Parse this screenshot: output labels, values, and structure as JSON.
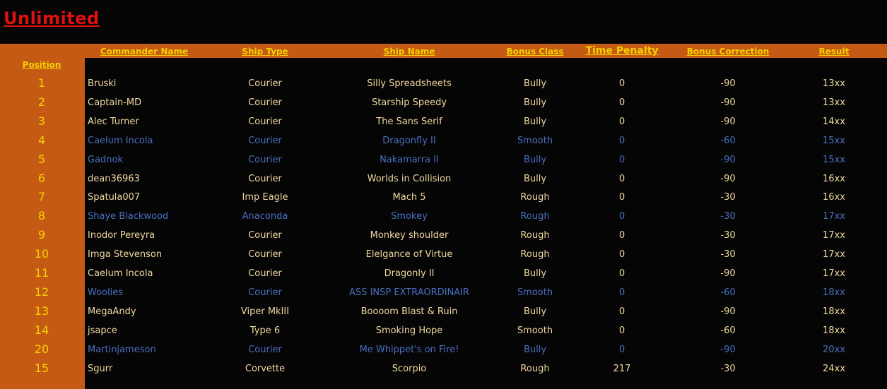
{
  "title": "Unlimited",
  "headers": {
    "position": "Position",
    "commander": "Commander Name",
    "ship_type": "Ship Type",
    "ship_name": "Ship Name",
    "bonus_class": "Bonus Class",
    "time_penalty": "Time Penalty",
    "bonus_correction": "Bonus Correction",
    "result": "Result"
  },
  "rows": [
    {
      "position": "1",
      "commander": "Bruski",
      "ship_type": "Courier",
      "ship_name": "Silly Spreadsheets",
      "bonus_class": "Bully",
      "time_penalty": "0",
      "bonus_correction": "-90",
      "result": "13xx",
      "highlight": false
    },
    {
      "position": "2",
      "commander": "Captain-MD",
      "ship_type": "Courier",
      "ship_name": "Starship Speedy",
      "bonus_class": "Bully",
      "time_penalty": "0",
      "bonus_correction": "-90",
      "result": "13xx",
      "highlight": false
    },
    {
      "position": "3",
      "commander": "Alec Turner",
      "ship_type": "Courier",
      "ship_name": "The Sans Serif",
      "bonus_class": "Bully",
      "time_penalty": "0",
      "bonus_correction": "-90",
      "result": "14xx",
      "highlight": false
    },
    {
      "position": "4",
      "commander": "Caelum Incola",
      "ship_type": "Courier",
      "ship_name": "Dragonfly II",
      "bonus_class": "Smooth",
      "time_penalty": "0",
      "bonus_correction": "-60",
      "result": "15xx",
      "highlight": true
    },
    {
      "position": "5",
      "commander": "Gadnok",
      "ship_type": "Courier",
      "ship_name": "Nakamarra II",
      "bonus_class": "Bully",
      "time_penalty": "0",
      "bonus_correction": "-90",
      "result": "15xx",
      "highlight": true
    },
    {
      "position": "6",
      "commander": "dean36963",
      "ship_type": "Courier",
      "ship_name": "Worlds in Collision",
      "bonus_class": "Bully",
      "time_penalty": "0",
      "bonus_correction": "-90",
      "result": "16xx",
      "highlight": false
    },
    {
      "position": "7",
      "commander": "Spatula007",
      "ship_type": "Imp Eagle",
      "ship_name": "Mach 5",
      "bonus_class": "Rough",
      "time_penalty": "0",
      "bonus_correction": "-30",
      "result": "16xx",
      "highlight": false
    },
    {
      "position": "8",
      "commander": "Shaye Blackwood",
      "ship_type": "Anaconda",
      "ship_name": "Smokey",
      "bonus_class": "Rough",
      "time_penalty": "0",
      "bonus_correction": "-30",
      "result": "17xx",
      "highlight": true
    },
    {
      "position": "9",
      "commander": "Inodor Pereyra",
      "ship_type": "Courier",
      "ship_name": "Monkey shoulder",
      "bonus_class": "Rough",
      "time_penalty": "0",
      "bonus_correction": "-30",
      "result": "17xx",
      "highlight": false
    },
    {
      "position": "10",
      "commander": "Imga Stevenson",
      "ship_type": "Courier",
      "ship_name": "Elelgance of Virtue",
      "bonus_class": "Rough",
      "time_penalty": "0",
      "bonus_correction": "-30",
      "result": "17xx",
      "highlight": false
    },
    {
      "position": "11",
      "commander": "Caelum Incola",
      "ship_type": "Courier",
      "ship_name": "Dragonly II",
      "bonus_class": "Bully",
      "time_penalty": "0",
      "bonus_correction": "-90",
      "result": "17xx",
      "highlight": false
    },
    {
      "position": "12",
      "commander": "Woolies",
      "ship_type": "Courier",
      "ship_name": "ASS INSP EXTRAORDINAIR",
      "bonus_class": "Smooth",
      "time_penalty": "0",
      "bonus_correction": "-60",
      "result": "18xx",
      "highlight": true
    },
    {
      "position": "13",
      "commander": "MegaAndy",
      "ship_type": "Viper MkIII",
      "ship_name": "Boooom Blast & Ruin",
      "bonus_class": "Bully",
      "time_penalty": "0",
      "bonus_correction": "-90",
      "result": "18xx",
      "highlight": false
    },
    {
      "position": "14",
      "commander": "jsapce",
      "ship_type": "Type 6",
      "ship_name": "Smoking Hope",
      "bonus_class": "Smooth",
      "time_penalty": "0",
      "bonus_correction": "-60",
      "result": "18xx",
      "highlight": false
    },
    {
      "position": "20",
      "commander": "Martinjameson",
      "ship_type": "Courier",
      "ship_name": "Me Whippet's on Fire!",
      "bonus_class": "Bully",
      "time_penalty": "0",
      "bonus_correction": "-90",
      "result": "20xx",
      "highlight": true
    },
    {
      "position": "15",
      "commander": "Sgurr",
      "ship_type": "Corvette",
      "ship_name": "Scorpio",
      "bonus_class": "Rough",
      "time_penalty": "217",
      "bonus_correction": "-30",
      "result": "24xx",
      "highlight": false
    }
  ],
  "colors": {
    "title": "#e01010",
    "header": "#f4d000",
    "band": "#c45a14",
    "text": "#f0d8a0",
    "highlight_text": "#4a6fc0",
    "background": "#050505"
  }
}
